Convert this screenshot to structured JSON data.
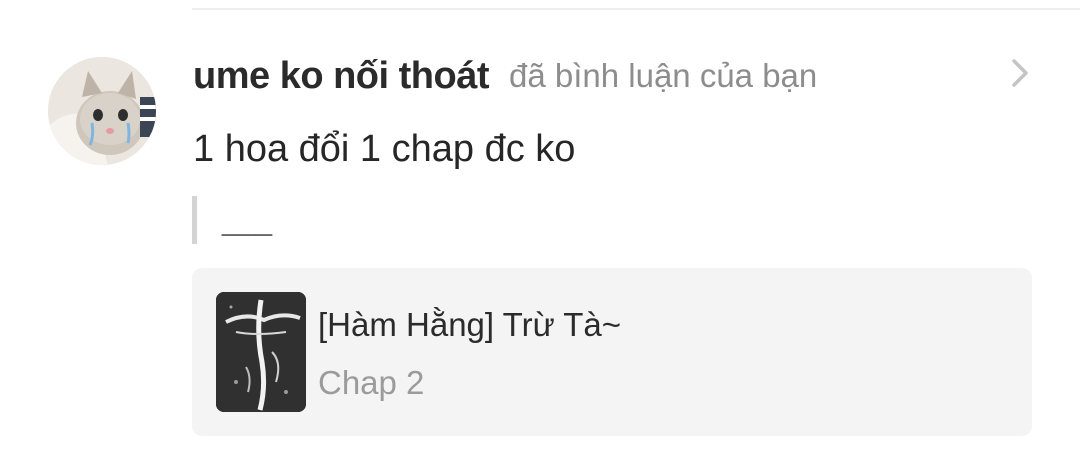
{
  "notification": {
    "username": "ume ko nối thoát",
    "action": "đã bình luận của bạn",
    "comment": "1 hoa đổi 1 chap đc ko",
    "quoted_text": "___"
  },
  "card": {
    "title": "[Hàm Hằng] Trừ Tà~",
    "chapter": "Chap 2"
  },
  "icons": {
    "avatar": "cat-avatar-icon",
    "chevron": "chevron-right-icon",
    "thumbnail": "cross-artwork-thumbnail"
  },
  "colors": {
    "username": "#2b2b2b",
    "muted": "#8d8d8d",
    "card_bg": "#f4f4f4"
  }
}
